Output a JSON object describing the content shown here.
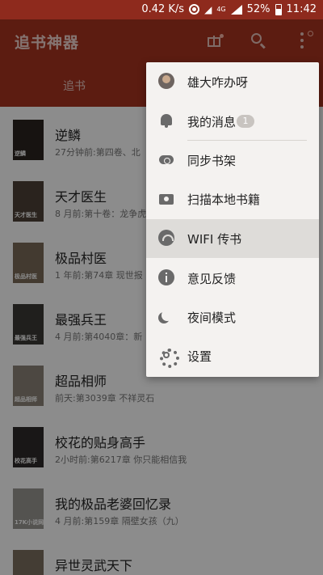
{
  "status_bar": {
    "speed": "0.42 K/s",
    "network": "4G",
    "battery": "52%",
    "time": "11:42"
  },
  "app": {
    "title": "追书神器",
    "tab": "追书",
    "accent_color": "#a8331f"
  },
  "books": [
    {
      "title": "逆鳞",
      "sub": "27分钟前:第四卷、北",
      "cover_text": "逆鳞"
    },
    {
      "title": "天才医生",
      "sub": "8 月前:第十卷：龙争虎",
      "cover_text": "天才医生"
    },
    {
      "title": "极品村医",
      "sub": "1 年前:第74章 现世报",
      "cover_text": "极品村医"
    },
    {
      "title": "最强兵王",
      "sub": "4 月前:第4040章：新",
      "cover_text": "最强兵王"
    },
    {
      "title": "超品相师",
      "sub": "前天:第3039章 不祥灵石",
      "cover_text": "超品相师"
    },
    {
      "title": "校花的贴身高手",
      "sub": "2小时前:第6217章 你只能相信我",
      "cover_text": "校花高手"
    },
    {
      "title": "我的极品老婆回忆录",
      "sub": "4 月前:第159章 隔壁女孩（九）",
      "cover_text": "17K小说网"
    },
    {
      "title": "异世灵武天下",
      "sub": "",
      "cover_text": ""
    }
  ],
  "menu": {
    "items": [
      {
        "label": "雄大咋办呀",
        "icon": "avatar-icon"
      },
      {
        "label": "我的消息",
        "icon": "bell-icon",
        "badge": "1"
      },
      {
        "label": "同步书架",
        "icon": "cloud-sync-icon"
      },
      {
        "label": "扫描本地书籍",
        "icon": "camera-icon"
      },
      {
        "label": "WIFI 传书",
        "icon": "wifi-icon"
      },
      {
        "label": "意见反馈",
        "icon": "info-icon"
      },
      {
        "label": "夜间模式",
        "icon": "moon-icon"
      },
      {
        "label": "设置",
        "icon": "gear-icon"
      }
    ]
  }
}
